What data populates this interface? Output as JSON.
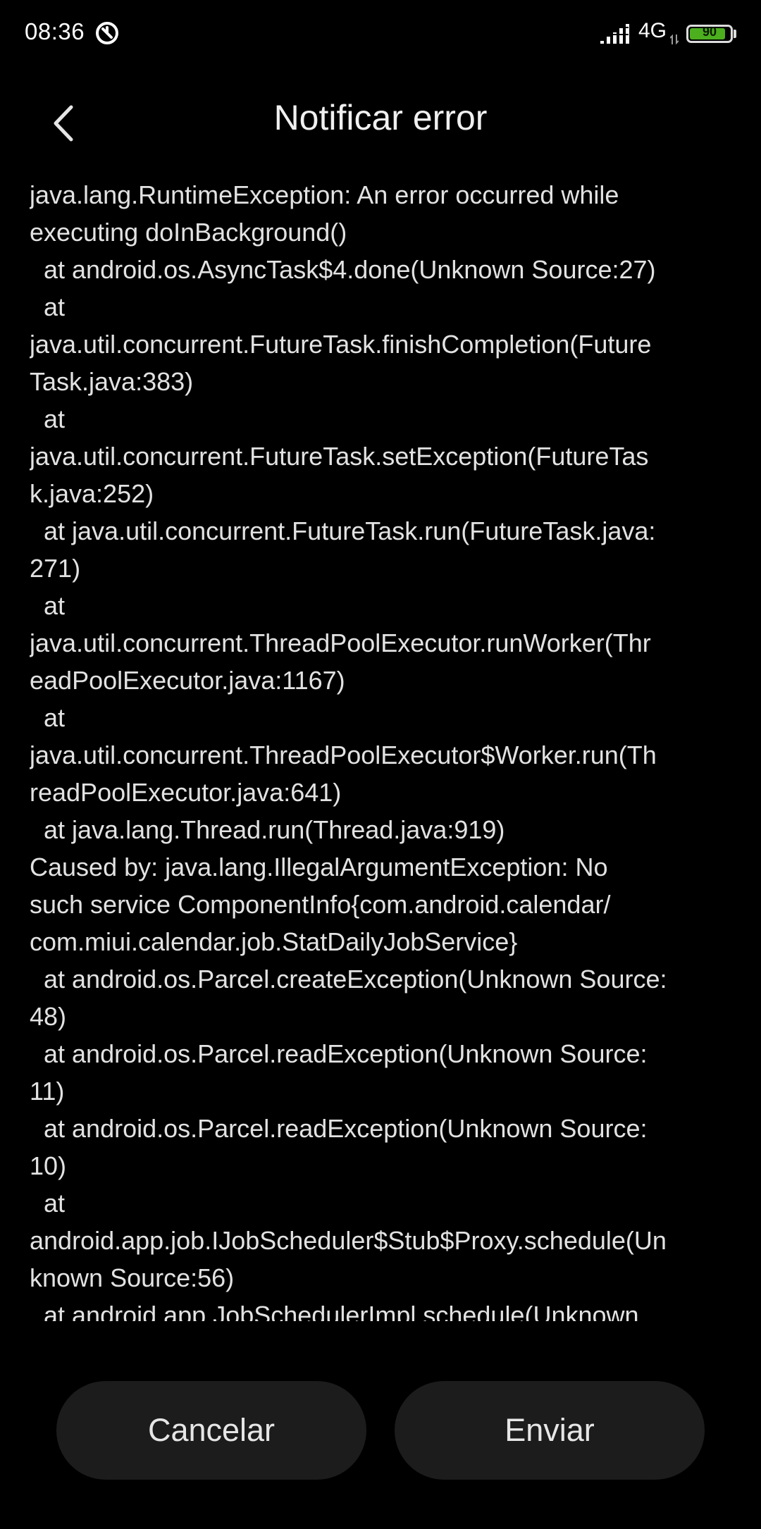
{
  "status_bar": {
    "time": "08:36",
    "network": "4G",
    "battery_level": "90",
    "battery_fraction": 0.9,
    "battery_color": "#4caf1e"
  },
  "header": {
    "title": "Notificar error",
    "back_icon": "chevron-left-icon"
  },
  "log": {
    "lines": [
      "java.lang.RuntimeException: An error occurred while",
      "executing doInBackground()",
      "  at android.os.AsyncTask$4.done(Unknown Source:27)",
      "  at",
      "java.util.concurrent.FutureTask.finishCompletion(Future",
      "Task.java:383)",
      "  at",
      "java.util.concurrent.FutureTask.setException(FutureTas",
      "k.java:252)",
      "  at java.util.concurrent.FutureTask.run(FutureTask.java:",
      "271)",
      "  at",
      "java.util.concurrent.ThreadPoolExecutor.runWorker(Thr",
      "eadPoolExecutor.java:1167)",
      "  at",
      "java.util.concurrent.ThreadPoolExecutor$Worker.run(Th",
      "readPoolExecutor.java:641)",
      "  at java.lang.Thread.run(Thread.java:919)",
      "Caused by: java.lang.IllegalArgumentException: No",
      "such service ComponentInfo{com.android.calendar/",
      "com.miui.calendar.job.StatDailyJobService}",
      "  at android.os.Parcel.createException(Unknown Source:",
      "48)",
      "  at android.os.Parcel.readException(Unknown Source:",
      "11)",
      "  at android.os.Parcel.readException(Unknown Source:",
      "10)",
      "  at",
      "android.app.job.IJobScheduler$Stub$Proxy.schedule(Un",
      "known Source:56)",
      "  at android.app.JobSchedulerImpl.schedule(Unknown"
    ]
  },
  "actions": {
    "cancel_label": "Cancelar",
    "send_label": "Enviar"
  }
}
